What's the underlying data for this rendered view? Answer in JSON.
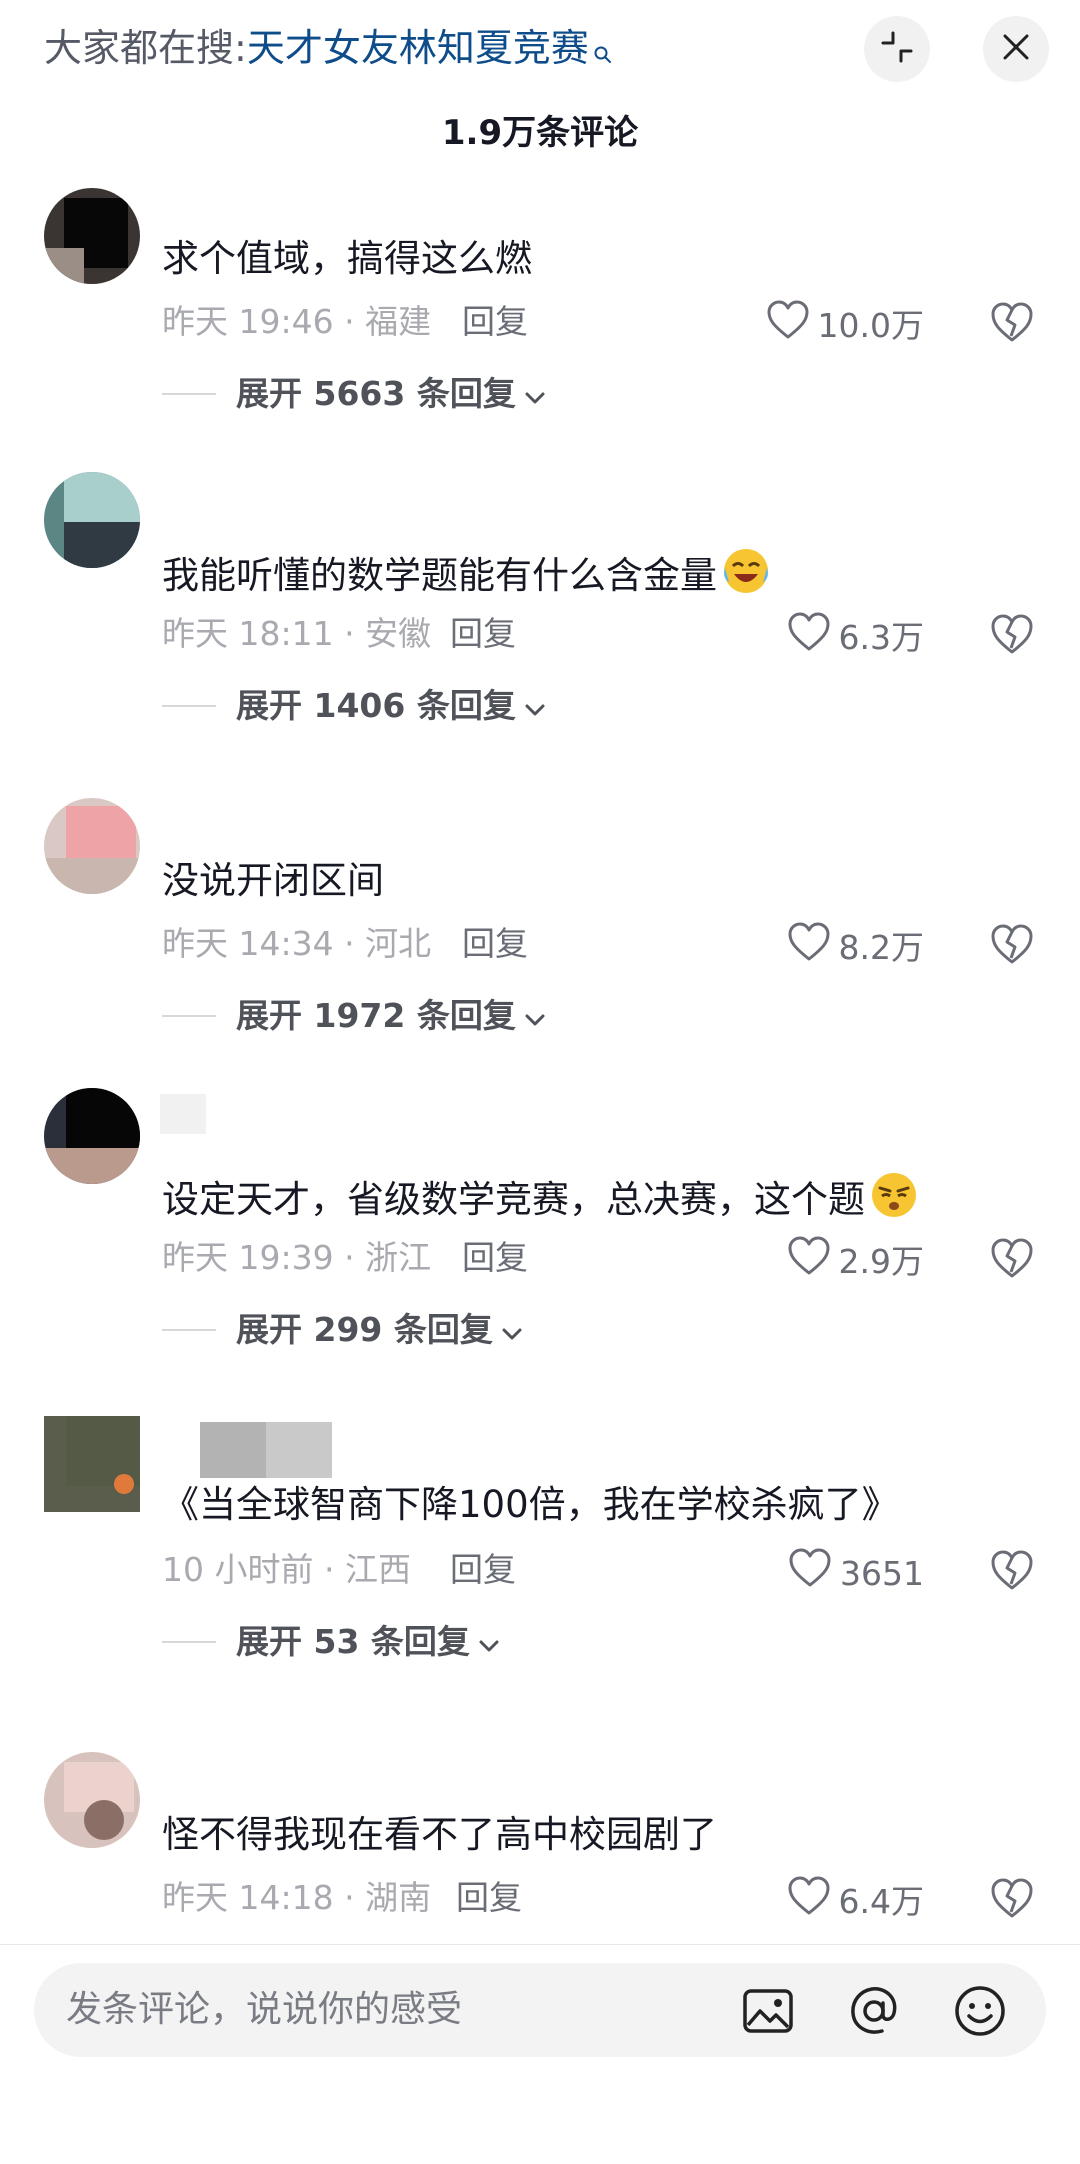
{
  "header": {
    "search_prefix": "大家都在搜:",
    "search_term": "天才女友林知夏竞赛",
    "comment_count": "1.9万条评论",
    "collapse_icon": "collapse-arrows-icon",
    "close_icon": "close-icon"
  },
  "comments": [
    {
      "text": "求个值域，搞得这么燃",
      "time": "昨天 19:46",
      "location": "福建",
      "reply_label": "回复",
      "likes": "10.0万",
      "expand": "展开 5663 条回复"
    },
    {
      "text": "我能听懂的数学题能有什么含金量",
      "emoji": "laughing-crying-emoji",
      "time": "昨天 18:11",
      "location": "安徽",
      "reply_label": "回复",
      "likes": "6.3万",
      "expand": "展开 1406 条回复"
    },
    {
      "text": "没说开闭区间",
      "time": "昨天 14:34",
      "location": "河北",
      "reply_label": "回复",
      "likes": "8.2万",
      "expand": "展开 1972 条回复"
    },
    {
      "text": "设定天才，省级数学竞赛，总决赛，这个题",
      "emoji": "unamused-face-emoji",
      "time": "昨天 19:39",
      "location": "浙江",
      "reply_label": "回复",
      "likes": "2.9万",
      "expand": "展开 299 条回复"
    },
    {
      "text": "《当全球智商下降100倍，我在学校杀疯了》",
      "time": "10 小时前",
      "location": "江西",
      "reply_label": "回复",
      "likes": "3651",
      "expand": "展开 53 条回复"
    },
    {
      "text": "怪不得我现在看不了高中校园剧了",
      "time": "昨天 14:18",
      "location": "湖南",
      "reply_label": "回复",
      "likes": "6.4万"
    }
  ],
  "input_bar": {
    "placeholder": "发条评论，说说你的感受",
    "icons": [
      "image-icon",
      "at-icon",
      "emoji-icon"
    ]
  }
}
